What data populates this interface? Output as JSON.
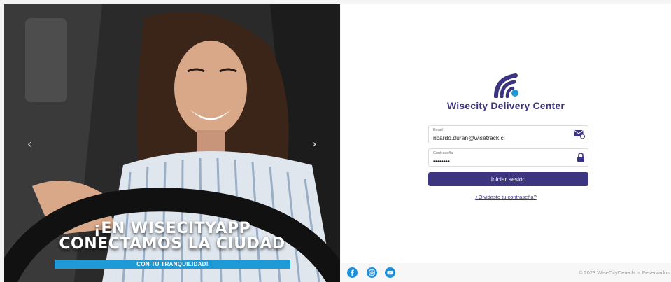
{
  "hero": {
    "headline_line1": "¡EN WISECITYAPP",
    "headline_line2": "CONECTAMOS LA CIUDAD",
    "tagline": "CON TU TRANQUILIDAD!",
    "prev_arrow": "‹",
    "next_arrow": "›"
  },
  "brand": {
    "name": "Wisecity Delivery Center",
    "color": "#3b3480",
    "accent": "#1e9ad6"
  },
  "form": {
    "email_label": "Email",
    "email_value": "ricardo.duran@wisetrack.cl",
    "email_icon": "envelope-icon",
    "password_label": "Contraseña",
    "password_value": "••••••••",
    "password_icon": "lock-icon",
    "submit_label": "Iniciar sesión",
    "forgot_label": "¿Olvidaste tu contraseña?"
  },
  "footer": {
    "social": [
      "facebook-icon",
      "instagram-icon",
      "youtube-icon"
    ],
    "copyright": "© 2023 WiseCityDerechos Reservados"
  }
}
